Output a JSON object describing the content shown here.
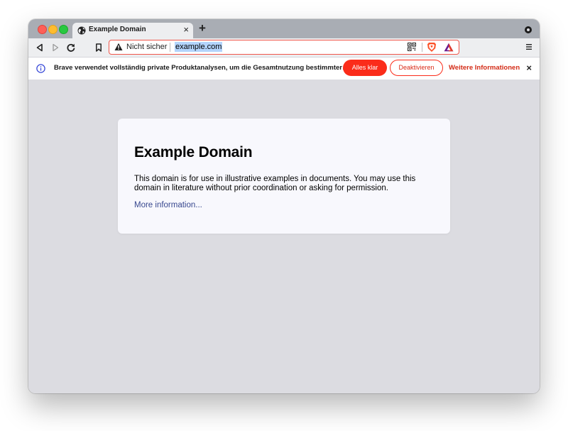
{
  "tab": {
    "title": "Example Domain",
    "close": "×",
    "new_tab": "+"
  },
  "toolbar": {
    "security_label": "Nicht sicher",
    "url": "example.com"
  },
  "infobar": {
    "message": "Brave verwendet vollständig private Produktanalysen, um die Gesamtnutzung bestimmter…",
    "ok_label": "Alles klar",
    "deactivate_label": "Deaktivieren",
    "more_label": "Weitere Informationen",
    "close": "×"
  },
  "page": {
    "title": "Example Domain",
    "body": "This domain is for use in illustrative examples in documents. You may use this domain in literature without prior coordination or asking for permission.",
    "link": "More information..."
  },
  "colors": {
    "brand_accent": "#fb2c1a",
    "page_background": "#dcdce1",
    "card_background": "#f8f8fd",
    "link": "#38488f",
    "info_icon": "#3a4bd8"
  }
}
